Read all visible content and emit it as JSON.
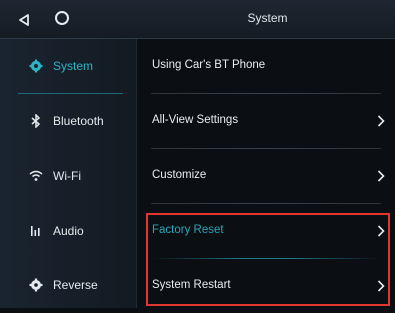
{
  "header": {
    "title": "System"
  },
  "sidebar": {
    "items": [
      {
        "label": "System",
        "icon": "gear-icon",
        "active": true
      },
      {
        "label": "Bluetooth",
        "icon": "bluetooth-icon"
      },
      {
        "label": "Wi-Fi",
        "icon": "wifi-icon"
      },
      {
        "label": "Audio",
        "icon": "equalizer-icon"
      },
      {
        "label": "Reverse",
        "icon": "gear-icon"
      }
    ]
  },
  "main": {
    "rows": [
      {
        "label": "Using Car's BT Phone",
        "chevron": false
      },
      {
        "label": "All-View Settings",
        "chevron": true
      },
      {
        "label": "Customize",
        "chevron": true
      },
      {
        "label": "Factory Reset",
        "chevron": true,
        "highlight": true
      },
      {
        "label": "System Restart",
        "chevron": true
      }
    ]
  },
  "colors": {
    "accent": "#2fb3c4",
    "highlight_box": "#e2372f"
  }
}
